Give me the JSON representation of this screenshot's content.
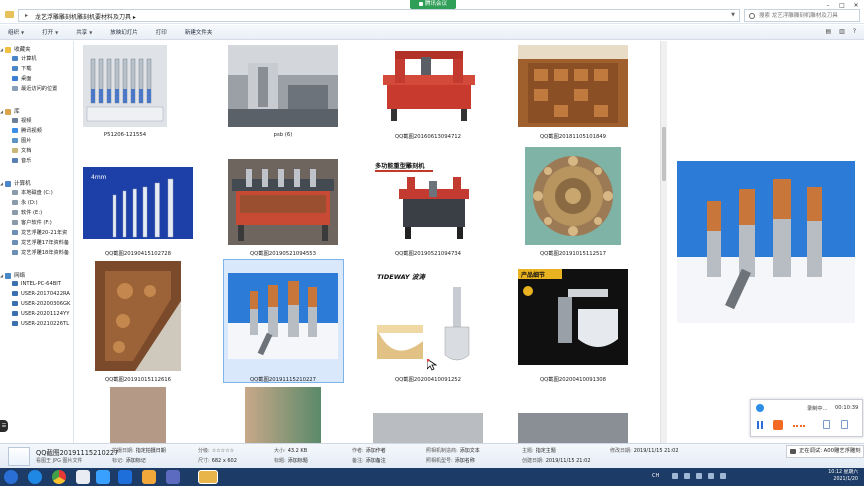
{
  "meeting": {
    "label": "腾讯会议"
  },
  "window": {
    "breadcrumb": "龙艺浮雕雕刻机雕刻机要材料及刀具 ▸",
    "search_placeholder": "搜索 龙艺浮雕雕刻机雕材及刀具"
  },
  "toolbar": {
    "items": [
      "组织",
      "打开",
      "共享",
      "放映幻灯片",
      "打印",
      "新建文件夹"
    ]
  },
  "nav": {
    "favorites": {
      "title": "收藏夹",
      "items": [
        "计算机",
        "下载",
        "桌面",
        "最近访问的位置"
      ]
    },
    "library": {
      "title": "库",
      "items": [
        "视频",
        "腾讯视频",
        "图片",
        "文档",
        "音乐"
      ]
    },
    "computer": {
      "title": "计算机",
      "items": [
        "本地磁盘 (C:)",
        "永 (D:)",
        "软件 (E:)",
        "客户软件 (F:)",
        "龙艺浮雕20-21年资",
        "龙艺浮雕17年资料备",
        "龙艺浮雕18年资料备"
      ]
    },
    "network": {
      "title": "网络",
      "items": [
        "INTEL-PC-64BIT",
        "USER-20170422RA",
        "USER-20200306GK",
        "USER-20201124YY",
        "USER-20210226TL"
      ]
    }
  },
  "files": [
    {
      "name": "P51206-121554"
    },
    {
      "name": "psb (6)"
    },
    {
      "name": "QQ截图20160613094712"
    },
    {
      "name": "QQ截图20181105101849"
    },
    {
      "name": "QQ截图20190415102728",
      "overlay": "4mm"
    },
    {
      "name": "QQ截图20190521094553"
    },
    {
      "name": "QQ截图20190521094734",
      "overlay": "多功能重型雕刻机"
    },
    {
      "name": "QQ截图20191015112517"
    },
    {
      "name": "QQ截图20191015112616"
    },
    {
      "name": "QQ截图20191115210227"
    },
    {
      "name": "QQ截图20200410091252",
      "overlay": "TIDEWAY 波涛"
    },
    {
      "name": "QQ截图20200410091308",
      "overlay": "产品细节"
    }
  ],
  "details": {
    "filename": "QQ截图20191115210227",
    "filetype": "看图王 JPG 图片文件",
    "fields": [
      {
        "label": "拍摄日期:",
        "value": "指定拍摄日期"
      },
      {
        "label": "标记:",
        "value": "添加标记"
      },
      {
        "label": "分级:",
        "value": "☆☆☆☆☆"
      },
      {
        "label": "尺寸:",
        "value": "682 x 602"
      },
      {
        "label": "大小:",
        "value": "43.2 KB"
      },
      {
        "label": "标题:",
        "value": "添加标题"
      },
      {
        "label": "作者:",
        "value": "添加作者"
      },
      {
        "label": "备注:",
        "value": "添加备注"
      },
      {
        "label": "照相机制造商:",
        "value": "添加文本"
      },
      {
        "label": "照相机型号:",
        "value": "添加名称"
      },
      {
        "label": "主题:",
        "value": "指定主题"
      },
      {
        "label": "创建日期:",
        "value": "2019/11/15 21:02"
      },
      {
        "label": "修改日期:",
        "value": "2019/11/15 21:02"
      }
    ]
  },
  "recorder": {
    "status": "录制中...",
    "time": "00:10:39"
  },
  "connection": {
    "text": "正在调试: A00雕艺浮雕刻"
  },
  "taskbar": {
    "ime": "CH",
    "time": "10:12 星期六",
    "date": "2021/1/20"
  },
  "colors": {
    "selection": "#d9e8fb",
    "taskbar": "#1c3b66",
    "record": "#f26a23"
  }
}
